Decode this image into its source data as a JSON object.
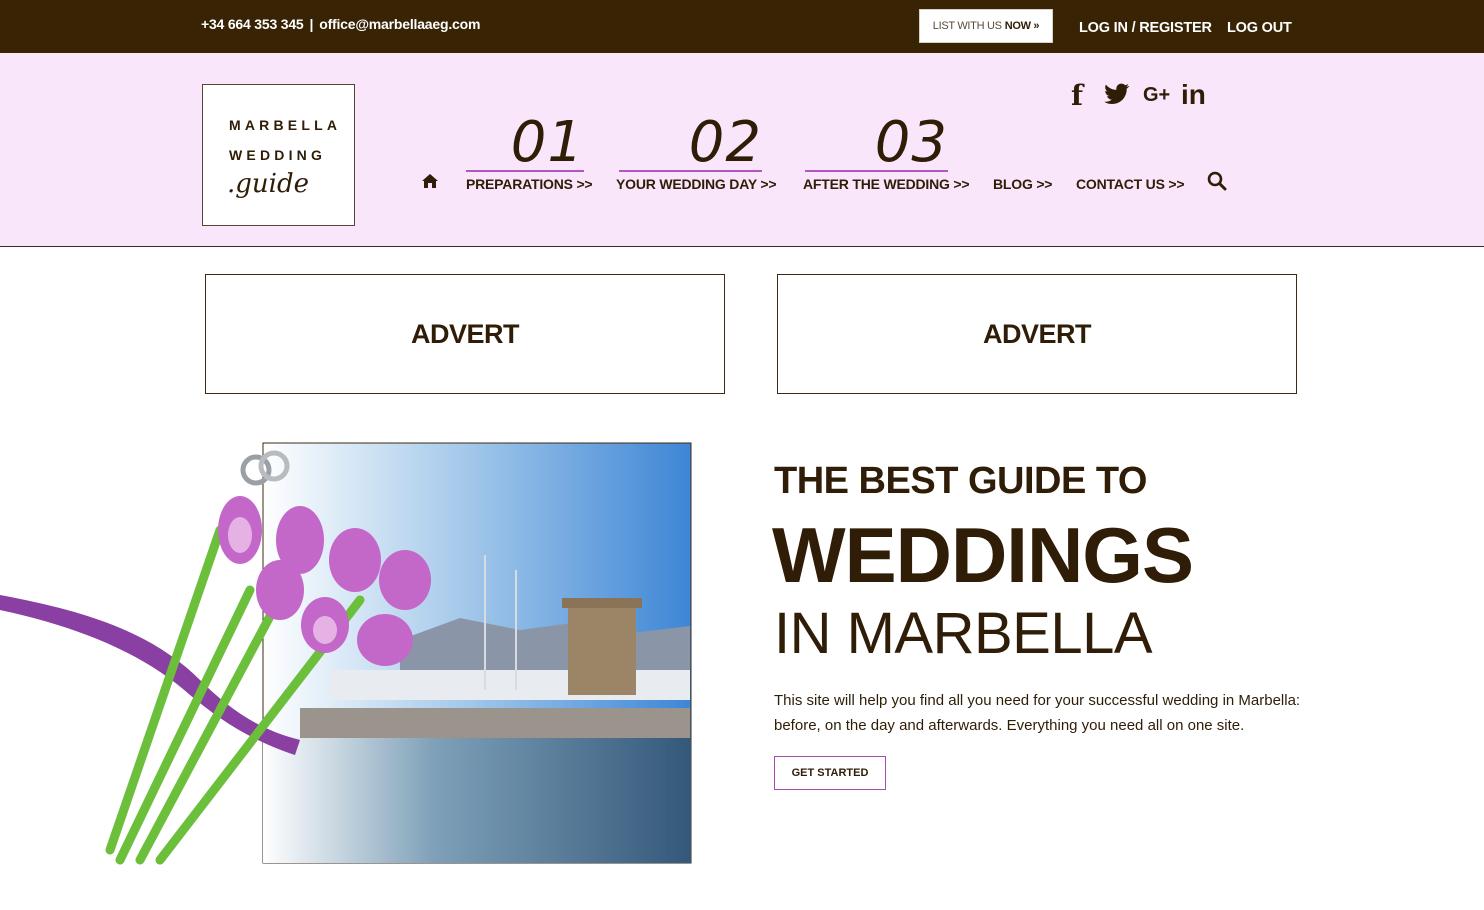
{
  "topbar": {
    "phone": "+34 664 353 345",
    "separator": "|",
    "email": "office@marbellaaeg.com",
    "list_with_us": "LIST WITH US",
    "list_now": "NOW »",
    "login": "LOG IN / REGISTER",
    "logout": "LOG OUT"
  },
  "logo": {
    "line1": "MARBELLA",
    "line2": "WEDDING",
    "line3": ".guide"
  },
  "social": {
    "facebook": "f",
    "twitter": "🐦",
    "googleplus": "G+",
    "linkedin": "in"
  },
  "nav": {
    "steps": [
      {
        "number": "01",
        "label": "PREPARATIONS >>"
      },
      {
        "number": "02",
        "label": "YOUR WEDDING DAY >>"
      },
      {
        "number": "03",
        "label": "AFTER THE WEDDING >>"
      }
    ],
    "blog": "BLOG >>",
    "contact": "CONTACT US >>"
  },
  "adverts": [
    "ADVERT",
    "ADVERT"
  ],
  "hero": {
    "line1": "THE BEST GUIDE TO",
    "line2": "WEDDINGS",
    "line3": "IN MARBELLA",
    "description": "This site will help you find all you need for your successful wedding in Marbella: before, on the day and afterwards.  Everything you need all on one site.",
    "cta": "GET STARTED"
  },
  "colors": {
    "topbar": "#382404",
    "header_bg": "#fae6fa",
    "text": "#2f1d07",
    "accent": "#b256c0"
  },
  "icons": [
    "home-icon",
    "search-icon",
    "facebook-icon",
    "twitter-icon",
    "googleplus-icon",
    "linkedin-icon"
  ]
}
